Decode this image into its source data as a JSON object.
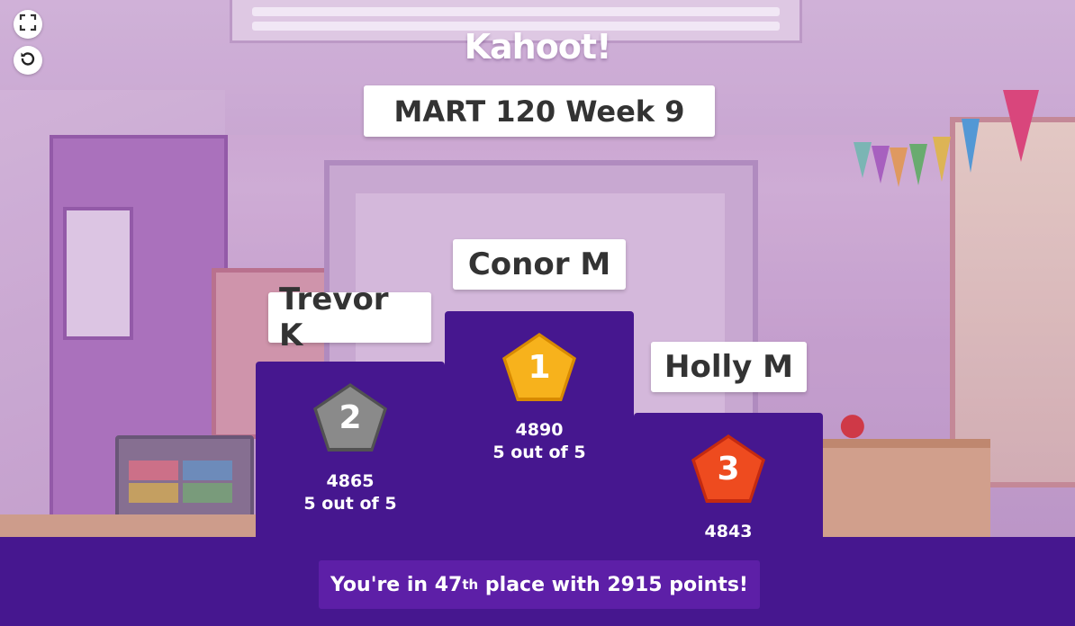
{
  "app": {
    "logo_text": "Kahoot!",
    "quiz_title": "MART 120 Week 9"
  },
  "controls": {
    "fullscreen_icon": "fullscreen-icon",
    "restart_icon": "restart-icon"
  },
  "podium": {
    "first": {
      "rank": "1",
      "name": "Conor M",
      "score": "4890",
      "correct": "5 out of 5",
      "badge_color": "#f5a623"
    },
    "second": {
      "rank": "2",
      "name": "Trevor K",
      "score": "4865",
      "correct": "5 out of 5",
      "badge_color": "#7a7a7a"
    },
    "third": {
      "rank": "3",
      "name": "Holly M",
      "score": "4843",
      "correct": "",
      "badge_color": "#e8361b"
    }
  },
  "result": {
    "prefix": "You're in",
    "place": "47",
    "place_suffix": "th",
    "suffix": "place with 2915 points!"
  },
  "colors": {
    "podium": "#46178f",
    "footer": "#46178f",
    "result_box": "#5d1fa7"
  }
}
